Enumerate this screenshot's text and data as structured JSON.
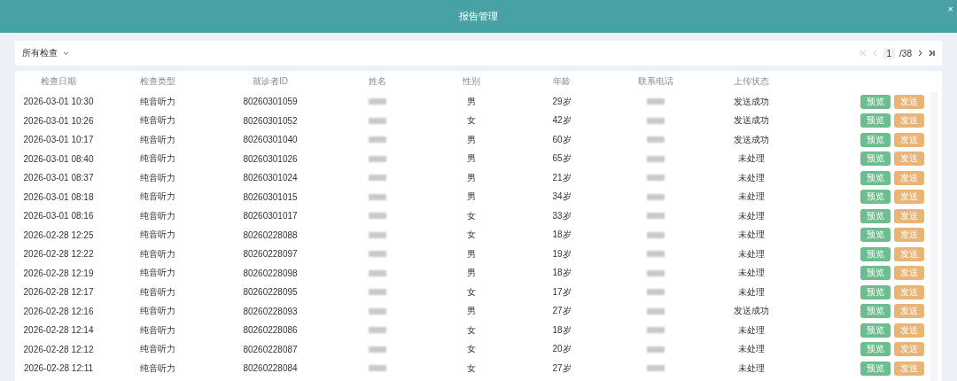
{
  "window": {
    "title": "报告管理",
    "close": "×"
  },
  "filter": {
    "label": "所有检查"
  },
  "pagination": {
    "current": "1",
    "total": "/38"
  },
  "table": {
    "columns": [
      "检查日期",
      "检查类型",
      "就诊者ID",
      "姓名",
      "性别",
      "年龄",
      "联系电话",
      "上传状态"
    ],
    "rows": [
      {
        "date": "2026-03-01 10:30",
        "type": "纯音听力",
        "id": "80260301059",
        "gender": "男",
        "age": "29岁",
        "status": "发送成功",
        "actions": [
          "预览",
          "发送"
        ]
      },
      {
        "date": "2026-03-01 10:26",
        "type": "纯音听力",
        "id": "80260301052",
        "gender": "女",
        "age": "42岁",
        "status": "发送成功",
        "actions": [
          "预览",
          "发送"
        ]
      },
      {
        "date": "2026-03-01 10:17",
        "type": "纯音听力",
        "id": "80260301040",
        "gender": "男",
        "age": "60岁",
        "status": "发送成功",
        "actions": [
          "预览",
          "发送"
        ]
      },
      {
        "date": "2026-03-01 08:40",
        "type": "纯音听力",
        "id": "80260301026",
        "gender": "男",
        "age": "65岁",
        "status": "未处理",
        "actions": [
          "预览",
          "发送"
        ]
      },
      {
        "date": "2026-03-01 08:37",
        "type": "纯音听力",
        "id": "80260301024",
        "gender": "男",
        "age": "21岁",
        "status": "未处理",
        "actions": [
          "预览",
          "发送"
        ]
      },
      {
        "date": "2026-03-01 08:18",
        "type": "纯音听力",
        "id": "80260301015",
        "gender": "男",
        "age": "34岁",
        "status": "未处理",
        "actions": [
          "预览",
          "发送"
        ]
      },
      {
        "date": "2026-03-01 08:16",
        "type": "纯音听力",
        "id": "80260301017",
        "gender": "女",
        "age": "33岁",
        "status": "未处理",
        "actions": [
          "预览",
          "发送"
        ]
      },
      {
        "date": "2026-02-28 12:25",
        "type": "纯音听力",
        "id": "80260228088",
        "gender": "女",
        "age": "18岁",
        "status": "未处理",
        "actions": [
          "预览",
          "发送"
        ]
      },
      {
        "date": "2026-02-28 12:22",
        "type": "纯音听力",
        "id": "80260228097",
        "gender": "男",
        "age": "19岁",
        "status": "未处理",
        "actions": [
          "预览",
          "发送"
        ]
      },
      {
        "date": "2026-02-28 12:19",
        "type": "纯音听力",
        "id": "80260228098",
        "gender": "男",
        "age": "18岁",
        "status": "未处理",
        "actions": [
          "预览",
          "发送"
        ]
      },
      {
        "date": "2026-02-28 12:17",
        "type": "纯音听力",
        "id": "80260228095",
        "gender": "女",
        "age": "17岁",
        "status": "未处理",
        "actions": [
          "预览",
          "发送"
        ]
      },
      {
        "date": "2026-02-28 12:16",
        "type": "纯音听力",
        "id": "80260228093",
        "gender": "男",
        "age": "27岁",
        "status": "发送成功",
        "actions": [
          "预览",
          "发送"
        ]
      },
      {
        "date": "2026-02-28 12:14",
        "type": "纯音听力",
        "id": "80260228086",
        "gender": "女",
        "age": "18岁",
        "status": "未处理",
        "actions": [
          "预览",
          "发送"
        ]
      },
      {
        "date": "2026-02-28 12:12",
        "type": "纯音听力",
        "id": "80260228087",
        "gender": "女",
        "age": "20岁",
        "status": "未处理",
        "actions": [
          "预览",
          "发送"
        ]
      },
      {
        "date": "2026-02-28 12:11",
        "type": "纯音听力",
        "id": "80260228084",
        "gender": "女",
        "age": "27岁",
        "status": "未处理",
        "actions": [
          "预览",
          "发送"
        ]
      }
    ]
  }
}
